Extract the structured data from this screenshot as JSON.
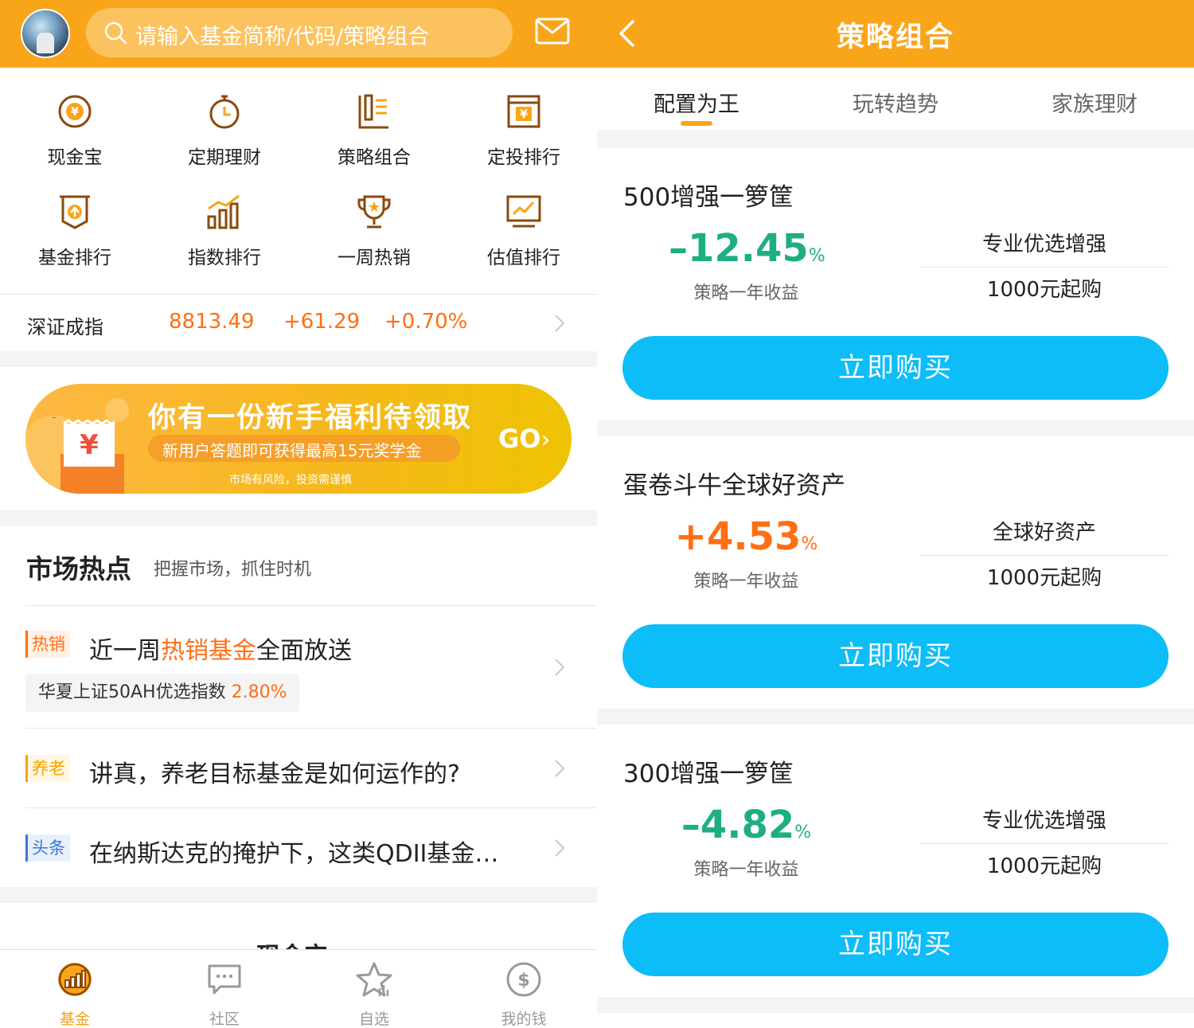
{
  "left": {
    "search": {
      "placeholder": "请输入基金简称/代码/策略组合"
    },
    "grid": [
      {
        "label": "现金宝",
        "icon": "cash-yen-icon"
      },
      {
        "label": "定期理财",
        "icon": "stopwatch-icon"
      },
      {
        "label": "策略组合",
        "icon": "strategy-doc-icon"
      },
      {
        "label": "定投排行",
        "icon": "calendar-yen-icon"
      },
      {
        "label": "基金排行",
        "icon": "arrow-up-shield-icon"
      },
      {
        "label": "指数排行",
        "icon": "bar-trend-icon"
      },
      {
        "label": "一周热销",
        "icon": "trophy-icon"
      },
      {
        "label": "估值排行",
        "icon": "chart-board-icon"
      }
    ],
    "index": {
      "name": "深证成指",
      "value": "8813.49",
      "change": "+61.29",
      "percent": "+0.70%"
    },
    "banner": {
      "title": "你有一份新手福利待领取",
      "subtitle": "新用户答题即可获得最高15元奖学金",
      "risk": "市场有风险，投资需谨慎",
      "go": "GO"
    },
    "market": {
      "title": "市场热点",
      "subtitle": "把握市场，抓住时机",
      "news": [
        {
          "tag": "热销",
          "title_pre": "近一周",
          "title_hl": "热销基金",
          "title_post": "全面放送",
          "fund": "华夏上证50AH优选指数",
          "fund_pct": "2.80%"
        },
        {
          "tag": "养老",
          "title": "讲真，养老目标基金是如何运作的?"
        },
        {
          "tag": "头条",
          "title": "在纳斯达克的掩护下，这类QDII基金…"
        }
      ],
      "partial_heading": "现金宝"
    },
    "bottom_nav": [
      {
        "label": "基金",
        "icon": "fund-chart-icon",
        "active": true
      },
      {
        "label": "社区",
        "icon": "chat-bubble-icon",
        "active": false
      },
      {
        "label": "自选",
        "icon": "star-icon",
        "active": false
      },
      {
        "label": "我的钱",
        "icon": "dollar-coin-icon",
        "active": false
      }
    ]
  },
  "right": {
    "title": "策略组合",
    "tabs": [
      "配置为王",
      "玩转趋势",
      "家族理财"
    ],
    "cards": [
      {
        "name": "500增强一箩筐",
        "return": "–12.45",
        "unit": "%",
        "sign": "neg",
        "return_label": "策略一年收益",
        "tag": "专业优选增强",
        "min": "1000元起购",
        "buy": "立即购买"
      },
      {
        "name": "蛋卷斗牛全球好资产",
        "return": "+4.53",
        "unit": "%",
        "sign": "pos",
        "return_label": "策略一年收益",
        "tag": "全球好资产",
        "min": "1000元起购",
        "buy": "立即购买"
      },
      {
        "name": "300增强一箩筐",
        "return": "–4.82",
        "unit": "%",
        "sign": "neg",
        "return_label": "策略一年收益",
        "tag": "专业优选增强",
        "min": "1000元起购",
        "buy": "立即购买"
      }
    ]
  },
  "colors": {
    "brand": "#f9a51a",
    "accent_orange": "#ff6e14",
    "positive_green": "#1fae84",
    "buy_blue": "#0dbdf7"
  }
}
